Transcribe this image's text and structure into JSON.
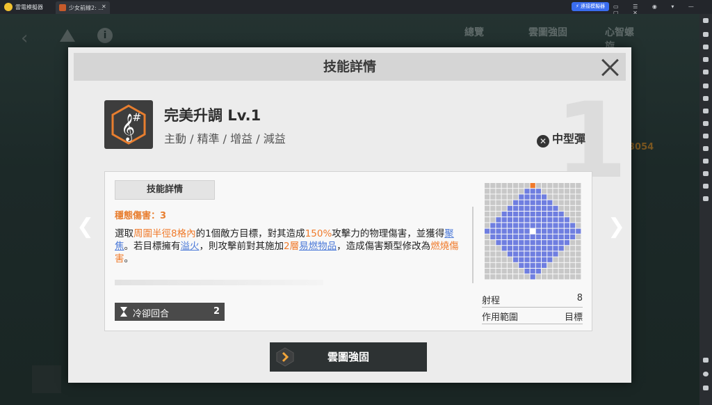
{
  "titlebar": {
    "app_name": "雷電模擬器",
    "tab_label": "少女前線2: ...",
    "tab_close": "✕",
    "connect_label": "⚡ 連接模擬器",
    "window_controls": "▭ ☰ ◉ ▾ — ▢ ✕"
  },
  "game": {
    "nav_tabs": [
      "總覽",
      "雲圖強固",
      "心智螺旋"
    ],
    "side_number": "3054"
  },
  "modal": {
    "title": "技能詳情",
    "background_number": "1",
    "skill": {
      "name": "完美升調 Lv.1",
      "tags": "主動 / 精準 / 增益 / 減益",
      "ammo_type": "中型彈"
    },
    "detail": {
      "tab_label": "技能詳情",
      "stable_damage": "穩態傷害：3",
      "desc": {
        "p1": "選取",
        "p2": "周圍半徑8格內",
        "p3": "的1個敵方目標，對其造成",
        "p4": "150%",
        "p5": "攻擊力的物理傷害，並獲得",
        "p6": "聚焦",
        "p7": "。若目標擁有",
        "p8": "溢火",
        "p9": "，則攻擊前對其施加",
        "p10": "2層",
        "p11": "易燃物品",
        "p12": "，造成傷害類型修改為",
        "p13": "燃燒傷害",
        "p14": "。"
      },
      "cooldown_label": "冷卻回合",
      "cooldown_value": "2",
      "range_label": "射程",
      "range_value": "8",
      "scope_label": "作用範圍",
      "scope_value": "目標"
    },
    "upgrade_button": "雲圖強固"
  },
  "colors": {
    "highlight_orange": "#f07a2a",
    "highlight_blue": "#4b79d8",
    "grid_range": "#6f7ee0",
    "grid_empty": "#c8c8c8",
    "grid_target": "#f07a2a"
  }
}
